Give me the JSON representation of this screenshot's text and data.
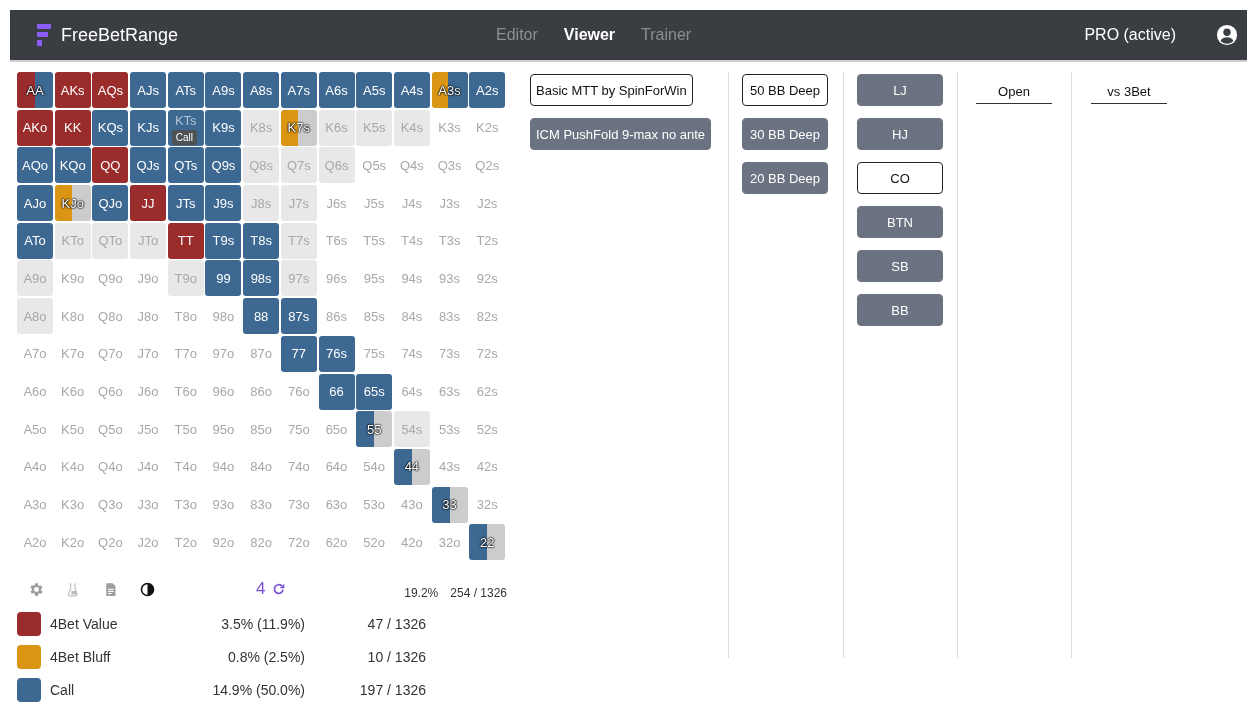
{
  "app": {
    "name": "FreeBetRange"
  },
  "nav": [
    {
      "label": "Editor",
      "selected": false
    },
    {
      "label": "Viewer",
      "selected": true
    },
    {
      "label": "Trainer",
      "selected": false
    }
  ],
  "account": {
    "label": "PRO (active)"
  },
  "grid": {
    "rows": [
      {
        "cells": [
          {
            "hand": "AA",
            "kind": "mixed",
            "segments": [
              {
                "kind": "value",
                "level": 0.5
              },
              {
                "kind": "call",
                "level": 0.5
              }
            ]
          },
          {
            "hand": "AKs",
            "kind": "value"
          },
          {
            "hand": "AQs",
            "kind": "value"
          },
          {
            "hand": "AJs",
            "kind": "call"
          },
          {
            "hand": "ATs",
            "kind": "call"
          },
          {
            "hand": "A9s",
            "kind": "call"
          },
          {
            "hand": "A8s",
            "kind": "call"
          },
          {
            "hand": "A7s",
            "kind": "call"
          },
          {
            "hand": "A6s",
            "kind": "call"
          },
          {
            "hand": "A5s",
            "kind": "call"
          },
          {
            "hand": "A4s",
            "kind": "call"
          },
          {
            "hand": "A3s",
            "kind": "mixed",
            "segments": [
              {
                "kind": "bluff",
                "level": 0.45
              },
              {
                "kind": "call",
                "level": 0.55
              }
            ]
          },
          {
            "hand": "A2s",
            "kind": "call"
          }
        ]
      },
      {
        "cells": [
          {
            "hand": "AKo",
            "kind": "value"
          },
          {
            "hand": "KK",
            "kind": "value"
          },
          {
            "hand": "KQs",
            "kind": "call"
          },
          {
            "hand": "KJs",
            "kind": "call"
          },
          {
            "hand": "KTs",
            "kind": "call",
            "tooltip": "Call"
          },
          {
            "hand": "K9s",
            "kind": "call"
          },
          {
            "hand": "K8s",
            "kind": "fold"
          },
          {
            "hand": "K7s",
            "kind": "mixed",
            "segments": [
              {
                "kind": "bluff",
                "level": 0.48
              },
              {
                "kind": "fold",
                "level": 0.52
              }
            ]
          },
          {
            "hand": "K6s",
            "kind": "fold"
          },
          {
            "hand": "K5s",
            "kind": "fold"
          },
          {
            "hand": "K4s",
            "kind": "fold"
          },
          {
            "hand": "K3s",
            "kind": "none"
          },
          {
            "hand": "K2s",
            "kind": "none"
          }
        ]
      },
      {
        "cells": [
          {
            "hand": "AQo",
            "kind": "call"
          },
          {
            "hand": "KQo",
            "kind": "call"
          },
          {
            "hand": "QQ",
            "kind": "value"
          },
          {
            "hand": "QJs",
            "kind": "call"
          },
          {
            "hand": "QTs",
            "kind": "call"
          },
          {
            "hand": "Q9s",
            "kind": "call"
          },
          {
            "hand": "Q8s",
            "kind": "fold"
          },
          {
            "hand": "Q7s",
            "kind": "fold"
          },
          {
            "hand": "Q6s",
            "kind": "fold"
          },
          {
            "hand": "Q5s",
            "kind": "none"
          },
          {
            "hand": "Q4s",
            "kind": "none"
          },
          {
            "hand": "Q3s",
            "kind": "none"
          },
          {
            "hand": "Q2s",
            "kind": "none"
          }
        ]
      },
      {
        "cells": [
          {
            "hand": "AJo",
            "kind": "call"
          },
          {
            "hand": "KJo",
            "kind": "mixed",
            "segments": [
              {
                "kind": "bluff",
                "level": 0.48
              },
              {
                "kind": "fold",
                "level": 0.52
              }
            ]
          },
          {
            "hand": "QJo",
            "kind": "call"
          },
          {
            "hand": "JJ",
            "kind": "value"
          },
          {
            "hand": "JTs",
            "kind": "call"
          },
          {
            "hand": "J9s",
            "kind": "call"
          },
          {
            "hand": "J8s",
            "kind": "fold"
          },
          {
            "hand": "J7s",
            "kind": "fold"
          },
          {
            "hand": "J6s",
            "kind": "none"
          },
          {
            "hand": "J5s",
            "kind": "none"
          },
          {
            "hand": "J4s",
            "kind": "none"
          },
          {
            "hand": "J3s",
            "kind": "none"
          },
          {
            "hand": "J2s",
            "kind": "none"
          }
        ]
      },
      {
        "cells": [
          {
            "hand": "ATo",
            "kind": "call"
          },
          {
            "hand": "KTo",
            "kind": "fold"
          },
          {
            "hand": "QTo",
            "kind": "fold"
          },
          {
            "hand": "JTo",
            "kind": "fold"
          },
          {
            "hand": "TT",
            "kind": "value"
          },
          {
            "hand": "T9s",
            "kind": "call"
          },
          {
            "hand": "T8s",
            "kind": "call"
          },
          {
            "hand": "T7s",
            "kind": "fold"
          },
          {
            "hand": "T6s",
            "kind": "none"
          },
          {
            "hand": "T5s",
            "kind": "none"
          },
          {
            "hand": "T4s",
            "kind": "none"
          },
          {
            "hand": "T3s",
            "kind": "none"
          },
          {
            "hand": "T2s",
            "kind": "none"
          }
        ]
      },
      {
        "cells": [
          {
            "hand": "A9o",
            "kind": "fold"
          },
          {
            "hand": "K9o",
            "kind": "none"
          },
          {
            "hand": "Q9o",
            "kind": "none"
          },
          {
            "hand": "J9o",
            "kind": "none"
          },
          {
            "hand": "T9o",
            "kind": "fold"
          },
          {
            "hand": "99",
            "kind": "call"
          },
          {
            "hand": "98s",
            "kind": "call"
          },
          {
            "hand": "97s",
            "kind": "fold"
          },
          {
            "hand": "96s",
            "kind": "none"
          },
          {
            "hand": "95s",
            "kind": "none"
          },
          {
            "hand": "94s",
            "kind": "none"
          },
          {
            "hand": "93s",
            "kind": "none"
          },
          {
            "hand": "92s",
            "kind": "none"
          }
        ]
      },
      {
        "cells": [
          {
            "hand": "A8o",
            "kind": "fold"
          },
          {
            "hand": "K8o",
            "kind": "none"
          },
          {
            "hand": "Q8o",
            "kind": "none"
          },
          {
            "hand": "J8o",
            "kind": "none"
          },
          {
            "hand": "T8o",
            "kind": "none"
          },
          {
            "hand": "98o",
            "kind": "none"
          },
          {
            "hand": "88",
            "kind": "call"
          },
          {
            "hand": "87s",
            "kind": "call"
          },
          {
            "hand": "86s",
            "kind": "none"
          },
          {
            "hand": "85s",
            "kind": "none"
          },
          {
            "hand": "84s",
            "kind": "none"
          },
          {
            "hand": "83s",
            "kind": "none"
          },
          {
            "hand": "82s",
            "kind": "none"
          }
        ]
      },
      {
        "cells": [
          {
            "hand": "A7o",
            "kind": "none"
          },
          {
            "hand": "K7o",
            "kind": "none"
          },
          {
            "hand": "Q7o",
            "kind": "none"
          },
          {
            "hand": "J7o",
            "kind": "none"
          },
          {
            "hand": "T7o",
            "kind": "none"
          },
          {
            "hand": "97o",
            "kind": "none"
          },
          {
            "hand": "87o",
            "kind": "none"
          },
          {
            "hand": "77",
            "kind": "call"
          },
          {
            "hand": "76s",
            "kind": "call"
          },
          {
            "hand": "75s",
            "kind": "none"
          },
          {
            "hand": "74s",
            "kind": "none"
          },
          {
            "hand": "73s",
            "kind": "none"
          },
          {
            "hand": "72s",
            "kind": "none"
          }
        ]
      },
      {
        "cells": [
          {
            "hand": "A6o",
            "kind": "none"
          },
          {
            "hand": "K6o",
            "kind": "none"
          },
          {
            "hand": "Q6o",
            "kind": "none"
          },
          {
            "hand": "J6o",
            "kind": "none"
          },
          {
            "hand": "T6o",
            "kind": "none"
          },
          {
            "hand": "96o",
            "kind": "none"
          },
          {
            "hand": "86o",
            "kind": "none"
          },
          {
            "hand": "76o",
            "kind": "none"
          },
          {
            "hand": "66",
            "kind": "call"
          },
          {
            "hand": "65s",
            "kind": "call"
          },
          {
            "hand": "64s",
            "kind": "none"
          },
          {
            "hand": "63s",
            "kind": "none"
          },
          {
            "hand": "62s",
            "kind": "none"
          }
        ]
      },
      {
        "cells": [
          {
            "hand": "A5o",
            "kind": "none"
          },
          {
            "hand": "K5o",
            "kind": "none"
          },
          {
            "hand": "Q5o",
            "kind": "none"
          },
          {
            "hand": "J5o",
            "kind": "none"
          },
          {
            "hand": "T5o",
            "kind": "none"
          },
          {
            "hand": "95o",
            "kind": "none"
          },
          {
            "hand": "85o",
            "kind": "none"
          },
          {
            "hand": "75o",
            "kind": "none"
          },
          {
            "hand": "65o",
            "kind": "none"
          },
          {
            "hand": "55",
            "kind": "mixed",
            "segments": [
              {
                "kind": "call",
                "level": 0.5
              },
              {
                "kind": "fold",
                "level": 0.5
              }
            ]
          },
          {
            "hand": "54s",
            "kind": "fold"
          },
          {
            "hand": "53s",
            "kind": "none"
          },
          {
            "hand": "52s",
            "kind": "none"
          }
        ]
      },
      {
        "cells": [
          {
            "hand": "A4o",
            "kind": "none"
          },
          {
            "hand": "K4o",
            "kind": "none"
          },
          {
            "hand": "Q4o",
            "kind": "none"
          },
          {
            "hand": "J4o",
            "kind": "none"
          },
          {
            "hand": "T4o",
            "kind": "none"
          },
          {
            "hand": "94o",
            "kind": "none"
          },
          {
            "hand": "84o",
            "kind": "none"
          },
          {
            "hand": "74o",
            "kind": "none"
          },
          {
            "hand": "64o",
            "kind": "none"
          },
          {
            "hand": "54o",
            "kind": "none"
          },
          {
            "hand": "44",
            "kind": "mixed",
            "segments": [
              {
                "kind": "call",
                "level": 0.5
              },
              {
                "kind": "fold",
                "level": 0.5
              }
            ]
          },
          {
            "hand": "43s",
            "kind": "none"
          },
          {
            "hand": "42s",
            "kind": "none"
          }
        ]
      },
      {
        "cells": [
          {
            "hand": "A3o",
            "kind": "none"
          },
          {
            "hand": "K3o",
            "kind": "none"
          },
          {
            "hand": "Q3o",
            "kind": "none"
          },
          {
            "hand": "J3o",
            "kind": "none"
          },
          {
            "hand": "T3o",
            "kind": "none"
          },
          {
            "hand": "93o",
            "kind": "none"
          },
          {
            "hand": "83o",
            "kind": "none"
          },
          {
            "hand": "73o",
            "kind": "none"
          },
          {
            "hand": "63o",
            "kind": "none"
          },
          {
            "hand": "53o",
            "kind": "none"
          },
          {
            "hand": "43o",
            "kind": "none"
          },
          {
            "hand": "33",
            "kind": "mixed",
            "segments": [
              {
                "kind": "call",
                "level": 0.5
              },
              {
                "kind": "fold",
                "level": 0.5
              }
            ]
          },
          {
            "hand": "32s",
            "kind": "none"
          }
        ]
      },
      {
        "cells": [
          {
            "hand": "A2o",
            "kind": "none"
          },
          {
            "hand": "K2o",
            "kind": "none"
          },
          {
            "hand": "Q2o",
            "kind": "none"
          },
          {
            "hand": "J2o",
            "kind": "none"
          },
          {
            "hand": "T2o",
            "kind": "none"
          },
          {
            "hand": "92o",
            "kind": "none"
          },
          {
            "hand": "82o",
            "kind": "none"
          },
          {
            "hand": "72o",
            "kind": "none"
          },
          {
            "hand": "62o",
            "kind": "none"
          },
          {
            "hand": "52o",
            "kind": "none"
          },
          {
            "hand": "42o",
            "kind": "none"
          },
          {
            "hand": "32o",
            "kind": "none"
          },
          {
            "hand": "22",
            "kind": "mixed",
            "segments": [
              {
                "kind": "call",
                "level": 0.5
              },
              {
                "kind": "fold",
                "level": 0.5
              }
            ]
          }
        ]
      }
    ]
  },
  "toolbar": {
    "count": "4",
    "percent": "19.2%",
    "combos": "254 / 1326"
  },
  "legend": [
    {
      "label": "4Bet Value",
      "color": "#9b2c2c",
      "percent": "3.5% (11.9%)",
      "combos": "47 / 1326"
    },
    {
      "label": "4Bet Bluff",
      "color": "#d99513",
      "percent": "0.8% (2.5%)",
      "combos": "10 / 1326"
    },
    {
      "label": "Call",
      "color": "#3d6891",
      "percent": "14.9% (50.0%)",
      "combos": "197 / 1326"
    }
  ],
  "columns": [
    {
      "kind": "buttons",
      "items": [
        {
          "label": "Basic MTT by SpinForWin",
          "selected": true
        },
        {
          "label": "ICM PushFold 9-max no ante",
          "selected": false
        }
      ]
    },
    {
      "kind": "buttons",
      "items": [
        {
          "label": "50 BB Deep",
          "selected": true
        },
        {
          "label": "30 BB Deep",
          "selected": false
        },
        {
          "label": "20 BB Deep",
          "selected": false
        }
      ]
    },
    {
      "kind": "buttons",
      "items": [
        {
          "label": "LJ",
          "selected": false
        },
        {
          "label": "HJ",
          "selected": false
        },
        {
          "label": "CO",
          "selected": true
        },
        {
          "label": "BTN",
          "selected": false
        },
        {
          "label": "SB",
          "selected": false
        },
        {
          "label": "BB",
          "selected": false
        }
      ]
    },
    {
      "kind": "tabs",
      "items": [
        {
          "label": "Open"
        }
      ]
    },
    {
      "kind": "tabs",
      "items": [
        {
          "label": "vs 3Bet"
        }
      ]
    }
  ]
}
